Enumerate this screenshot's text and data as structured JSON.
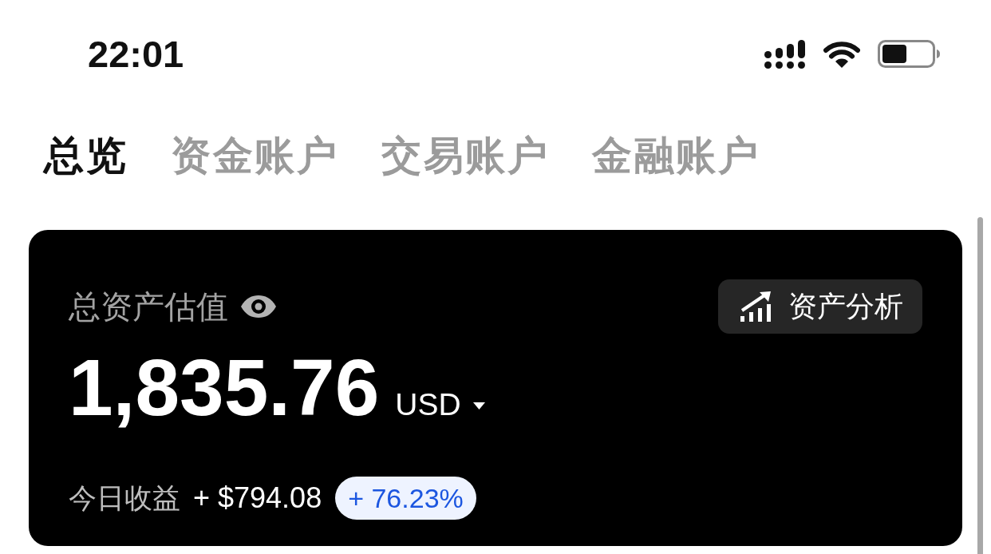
{
  "status_bar": {
    "time": "22:01"
  },
  "tabs": [
    {
      "label": "总览",
      "selected": true
    },
    {
      "label": "资金账户",
      "selected": false
    },
    {
      "label": "交易账户",
      "selected": false
    },
    {
      "label": "金融账户",
      "selected": false
    }
  ],
  "asset_card": {
    "label": "总资产估值",
    "analysis_button": "资产分析",
    "amount": "1,835.76",
    "currency": "USD",
    "today_label": "今日收益",
    "today_profit": "+ $794.08",
    "today_change": "+ 76.23%"
  }
}
